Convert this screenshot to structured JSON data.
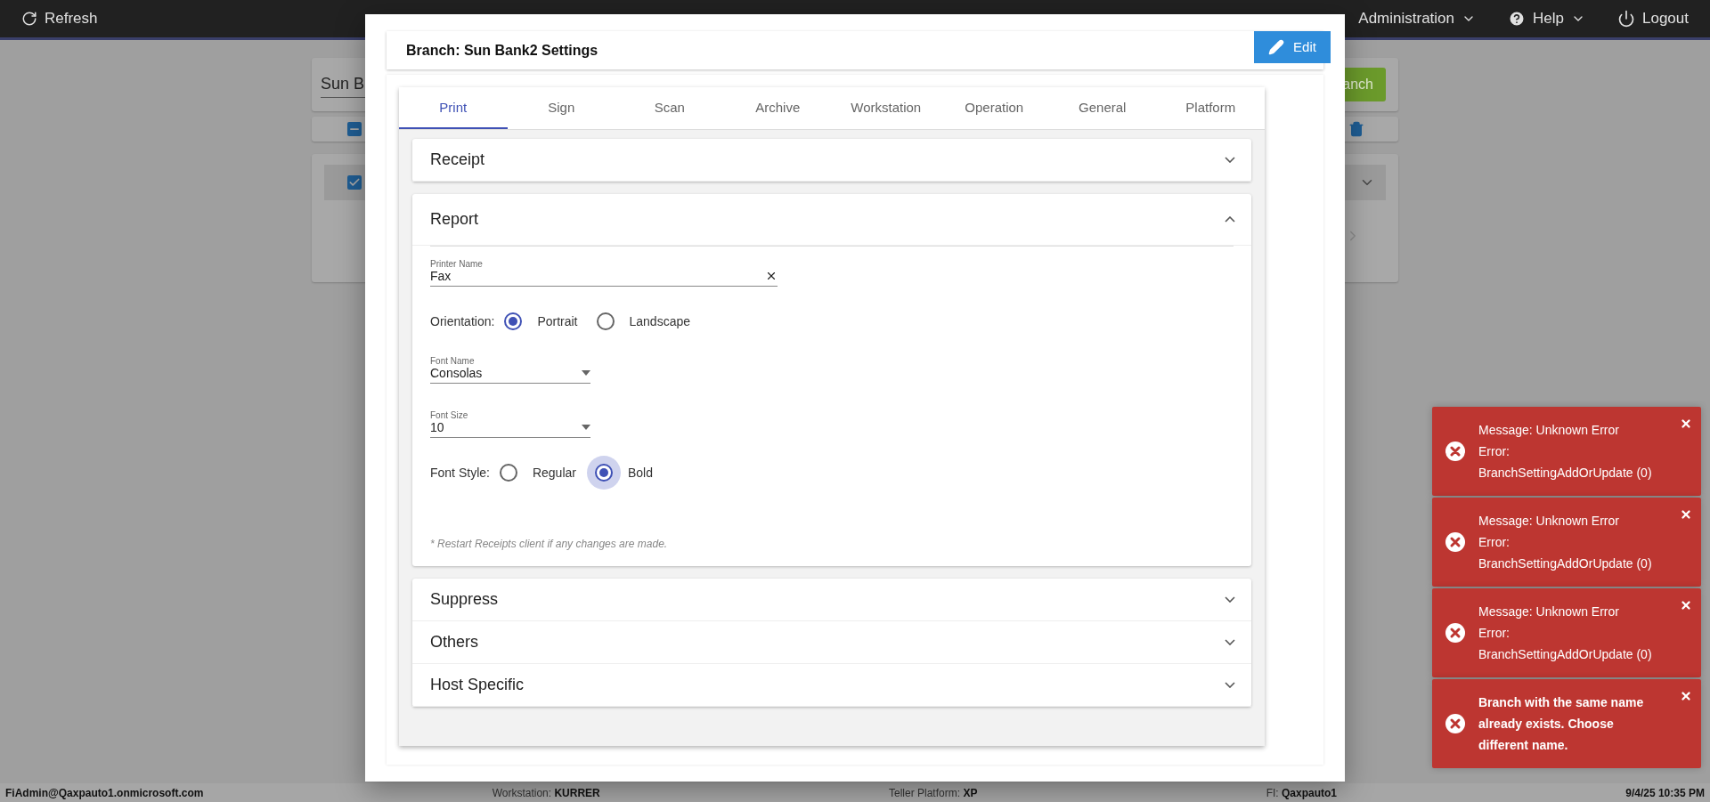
{
  "topbar": {
    "refresh": "Refresh",
    "menus": [
      {
        "label": "Administration",
        "kind": "dropdown"
      },
      {
        "label": "Help",
        "kind": "help"
      }
    ],
    "logout": "Logout"
  },
  "background": {
    "search_value": "Sun B",
    "add_button": "anch",
    "header_checkbox": {
      "partial": true
    },
    "row_checkbox": {
      "checked": true
    }
  },
  "modal": {
    "title": "Branch: Sun Bank2 Settings",
    "edit_button": "Edit",
    "tabs": [
      {
        "label": "Print",
        "selected": true
      },
      {
        "label": "Sign",
        "selected": false
      },
      {
        "label": "Scan",
        "selected": false
      },
      {
        "label": "Archive",
        "selected": false
      },
      {
        "label": "Workstation",
        "selected": false
      },
      {
        "label": "Operation",
        "selected": false
      },
      {
        "label": "General",
        "selected": false
      },
      {
        "label": "Platform",
        "selected": false
      }
    ],
    "sections": [
      {
        "title": "Receipt",
        "expanded": false
      },
      {
        "title": "Report",
        "expanded": true
      },
      {
        "title": "Suppress",
        "expanded": false
      },
      {
        "title": "Others",
        "expanded": false
      },
      {
        "title": "Host Specific",
        "expanded": false
      }
    ],
    "report": {
      "printer_name": {
        "label": "Printer Name",
        "value": "Fax"
      },
      "orientation": {
        "label": "Orientation:",
        "options": [
          {
            "label": "Portrait",
            "selected": true,
            "focused": false
          },
          {
            "label": "Landscape",
            "selected": false,
            "focused": false
          }
        ]
      },
      "font_name": {
        "label": "Font Name",
        "value": "Consolas"
      },
      "font_size": {
        "label": "Font Size",
        "value": "10"
      },
      "font_style": {
        "label": "Font Style:",
        "options": [
          {
            "label": "Regular",
            "selected": false,
            "focused": false
          },
          {
            "label": "Bold",
            "selected": true,
            "focused": true
          }
        ]
      },
      "note": "* Restart Receipts client if any changes are made."
    }
  },
  "toasts": [
    {
      "kind": "plain",
      "lines": [
        "Message: Unknown Error",
        "Error:",
        "BranchSettingAddOrUpdate (0)"
      ]
    },
    {
      "kind": "plain",
      "lines": [
        "Message: Unknown Error",
        "Error:",
        "BranchSettingAddOrUpdate (0)"
      ]
    },
    {
      "kind": "plain",
      "lines": [
        "Message: Unknown Error",
        "Error:",
        "BranchSettingAddOrUpdate (0)"
      ]
    },
    {
      "kind": "bold",
      "lines": [
        "Branch with the same name",
        "already exists. Choose",
        "different name."
      ]
    }
  ],
  "status_bar": {
    "user": "FiAdmin@Qaxpauto1.onmicrosoft.com",
    "workstation": {
      "label": "Workstation:",
      "value": "KURRER"
    },
    "platform": {
      "label": "Teller Platform:",
      "value": "XP"
    },
    "fi": {
      "label": "FI:",
      "value": "Qaxpauto1"
    },
    "datetime": "9/4/25 10:35 PM"
  }
}
